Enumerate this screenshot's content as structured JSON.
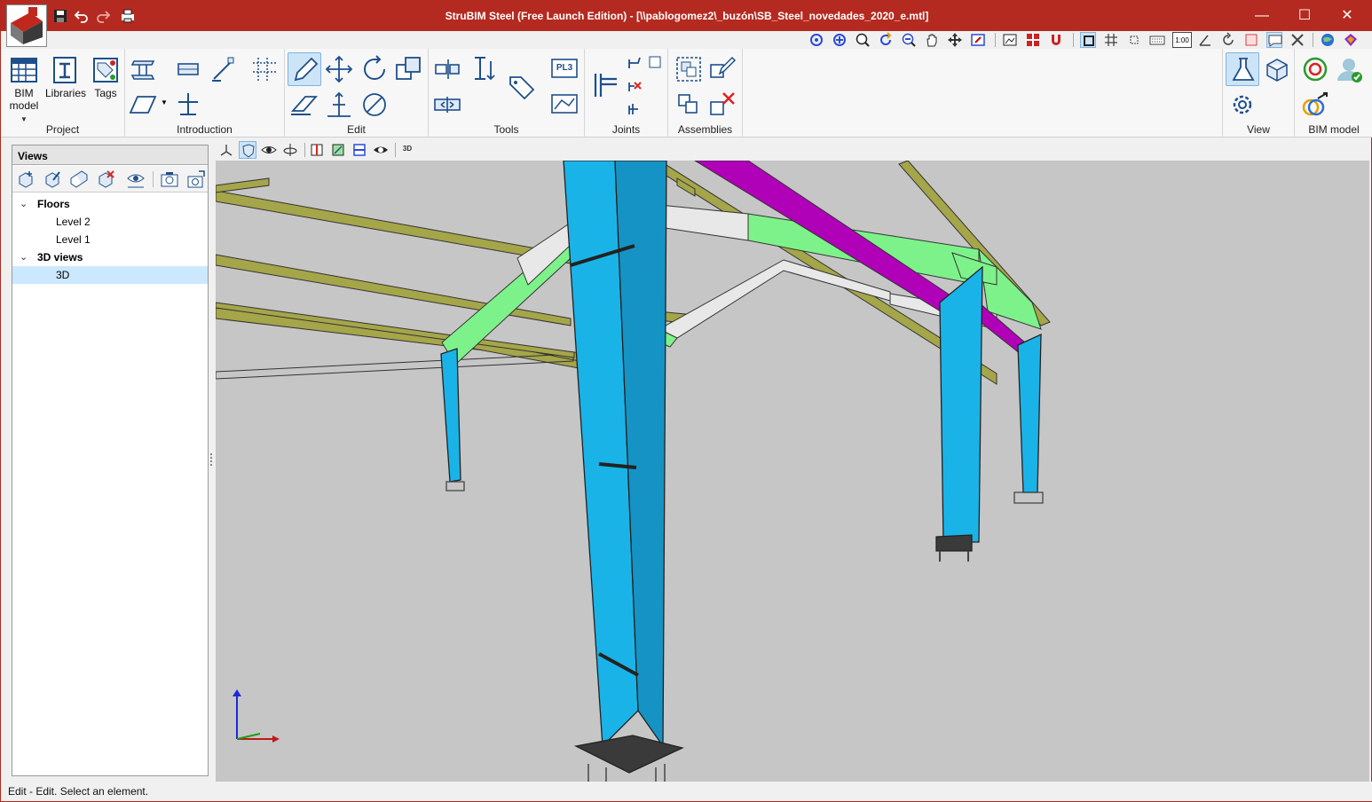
{
  "titlebar": {
    "title": "StruBIM Steel (Free Launch Edition) - [\\\\pablogomez2\\_buzón\\SB_Steel_novedades_2020_e.mtl]",
    "minimize": "—",
    "maximize": "☐",
    "close": "✕"
  },
  "ribbon": {
    "groups": [
      {
        "label": "Project"
      },
      {
        "label": "Introduction"
      },
      {
        "label": "Edit"
      },
      {
        "label": "Tools"
      },
      {
        "label": "Joints"
      },
      {
        "label": "Assemblies"
      },
      {
        "label": "View"
      },
      {
        "label": "BIM model"
      }
    ],
    "project": {
      "bim_model": "BIM",
      "bim_model_line2": "model",
      "libraries": "Libraries",
      "tags": "Tags"
    },
    "tools": {
      "pl3_badge": "PL3"
    }
  },
  "strip": {
    "scale_badge": "1:00"
  },
  "views_panel": {
    "title": "Views",
    "tree": [
      {
        "label": "Floors",
        "expanded": true,
        "bold": true
      },
      {
        "label": "Level 2"
      },
      {
        "label": "Level 1"
      },
      {
        "label": "3D views",
        "expanded": true,
        "bold": true
      },
      {
        "label": "3D",
        "selected": true
      }
    ]
  },
  "viewport_tools": {
    "badge_3d": "3D"
  },
  "status": {
    "text": "Edit - Edit. Select an element."
  },
  "colors": {
    "title_bar": "#b52a20",
    "column": "#1ab3e8",
    "purlin": "#a0a048",
    "brace_green": "#7ef28a",
    "beam_magenta": "#b000b8",
    "viewport_bg": "#c6c6c6",
    "active_tool": "#cde4f7"
  }
}
